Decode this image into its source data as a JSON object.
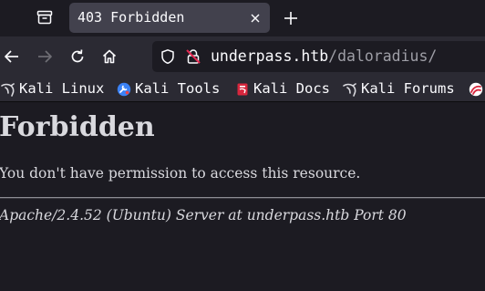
{
  "browser": {
    "tab": {
      "title": "403 Forbidden"
    },
    "url": {
      "host": "underpass.htb",
      "path": "/daloradius/"
    },
    "bookmarks": [
      {
        "label": "Kali Linux",
        "icon": "kali-dragon-icon"
      },
      {
        "label": "Kali Tools",
        "icon": "kali-tools-icon"
      },
      {
        "label": "Kali Docs",
        "icon": "kali-docs-icon"
      },
      {
        "label": "Kali Forums",
        "icon": "kali-dragon-icon"
      },
      {
        "label": "",
        "icon": "kali-nethunter-icon"
      }
    ],
    "colors": {
      "tabstrip": "#1c1b22",
      "toolbar": "#2b2a33",
      "active_tab": "#42414d",
      "text": "#fbfbfe",
      "url_path": "#9e9ea6",
      "insecure_lock": "#e22850"
    }
  },
  "page": {
    "heading": "Forbidden",
    "message": "You don't have permission to access this resource.",
    "footer": "Apache/2.4.52 (Ubuntu) Server at underpass.htb Port 80",
    "colors": {
      "background": "#1c1b22",
      "text": "#d9d9de"
    }
  }
}
